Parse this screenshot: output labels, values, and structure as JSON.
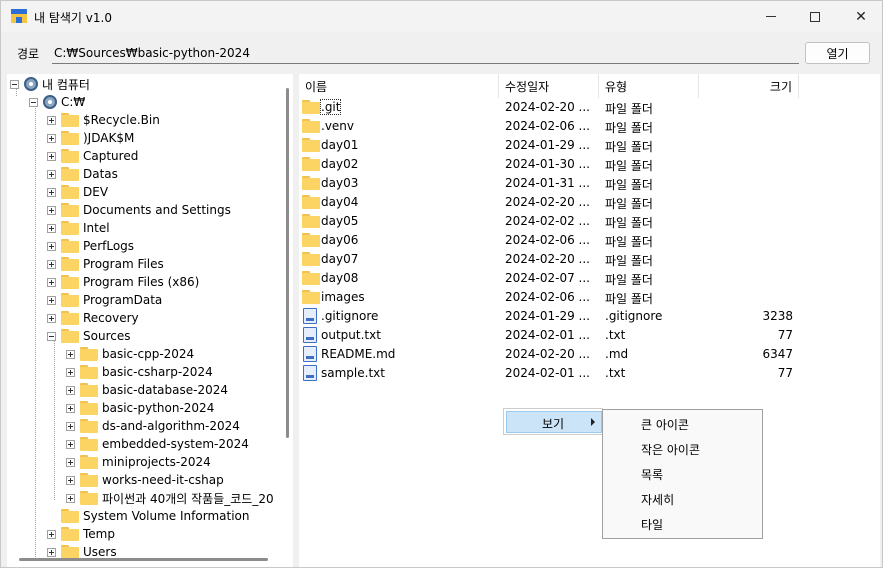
{
  "window": {
    "title": "내 탐색기 v1.0"
  },
  "path_bar": {
    "label": "경로",
    "value": "C:₩Sources₩basic-python-2024",
    "open_label": "열기"
  },
  "tree": {
    "root": "내 컴퓨터",
    "drive": "C:₩",
    "items": [
      "$Recycle.Bin",
      ")JDAK$M",
      "Captured",
      "Datas",
      "DEV",
      "Documents and Settings",
      "Intel",
      "PerfLogs",
      "Program Files",
      "Program Files (x86)",
      "ProgramData",
      "Recovery",
      "Sources"
    ],
    "sources_children": [
      "basic-cpp-2024",
      "basic-csharp-2024",
      "basic-database-2024",
      "basic-python-2024",
      "ds-and-algorithm-2024",
      "embedded-system-2024",
      "miniprojects-2024",
      "works-need-it-cshap",
      "파이썬과 40개의 작품들_코드_20"
    ],
    "after_items": [
      "System Volume Information",
      "Temp",
      "Users"
    ]
  },
  "list": {
    "columns": [
      "이름",
      "수정일자",
      "유형",
      "크기"
    ],
    "rows": [
      {
        "name": ".git",
        "date": "2024-02-20 ...",
        "type": "파일 폴더",
        "size": "",
        "icon": "folder-icon"
      },
      {
        "name": ".venv",
        "date": "2024-02-06 ...",
        "type": "파일 폴더",
        "size": "",
        "icon": "folder-icon"
      },
      {
        "name": "day01",
        "date": "2024-01-29 ...",
        "type": "파일 폴더",
        "size": "",
        "icon": "folder-icon"
      },
      {
        "name": "day02",
        "date": "2024-01-30 ...",
        "type": "파일 폴더",
        "size": "",
        "icon": "folder-icon"
      },
      {
        "name": "day03",
        "date": "2024-01-31 ...",
        "type": "파일 폴더",
        "size": "",
        "icon": "folder-icon"
      },
      {
        "name": "day04",
        "date": "2024-02-20 ...",
        "type": "파일 폴더",
        "size": "",
        "icon": "folder-icon"
      },
      {
        "name": "day05",
        "date": "2024-02-02 ...",
        "type": "파일 폴더",
        "size": "",
        "icon": "folder-icon"
      },
      {
        "name": "day06",
        "date": "2024-02-06 ...",
        "type": "파일 폴더",
        "size": "",
        "icon": "folder-icon"
      },
      {
        "name": "day07",
        "date": "2024-02-20 ...",
        "type": "파일 폴더",
        "size": "",
        "icon": "folder-icon"
      },
      {
        "name": "day08",
        "date": "2024-02-07 ...",
        "type": "파일 폴더",
        "size": "",
        "icon": "folder-icon"
      },
      {
        "name": "images",
        "date": "2024-02-06 ...",
        "type": "파일 폴더",
        "size": "",
        "icon": "folder-icon"
      },
      {
        "name": ".gitignore",
        "date": "2024-01-29 ...",
        "type": ".gitignore",
        "size": "3238",
        "icon": "file-icon"
      },
      {
        "name": "output.txt",
        "date": "2024-02-01 ...",
        "type": ".txt",
        "size": "77",
        "icon": "file-icon"
      },
      {
        "name": "README.md",
        "date": "2024-02-20 ...",
        "type": ".md",
        "size": "6347",
        "icon": "file-icon"
      },
      {
        "name": "sample.txt",
        "date": "2024-02-01 ...",
        "type": ".txt",
        "size": "77",
        "icon": "file-icon"
      }
    ]
  },
  "context_menu": {
    "view_label": "보기",
    "submenu": [
      "큰 아이콘",
      "작은 아이콘",
      "목록",
      "자세히",
      "타일"
    ]
  }
}
